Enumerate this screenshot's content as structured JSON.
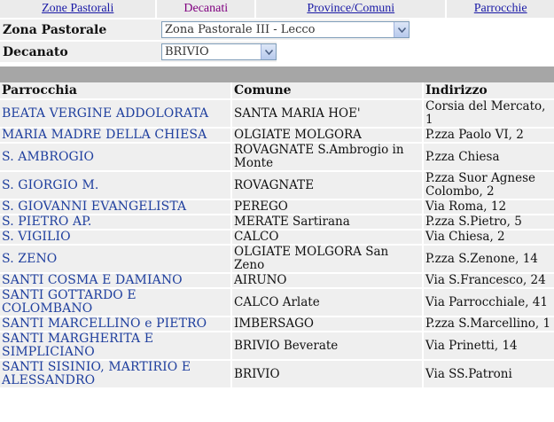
{
  "tabs": [
    {
      "label": "Zone Pastorali",
      "link": true
    },
    {
      "label": "Decanati",
      "link": false
    },
    {
      "label": "Province/Comuni",
      "link": true
    },
    {
      "label": "Parrocchie",
      "link": true
    }
  ],
  "filters": {
    "zona_label": "Zona Pastorale",
    "zona_value": "Zona Pastorale III - Lecco",
    "decanato_label": "Decanato",
    "decanato_value": "BRIVIO"
  },
  "table": {
    "headers": [
      "Parrocchia",
      "Comune",
      "Indirizzo"
    ],
    "rows": [
      {
        "parrocchia": "BEATA VERGINE ADDOLORATA",
        "comune": "SANTA MARIA HOE'",
        "indirizzo": "Corsia del Mercato, 1"
      },
      {
        "parrocchia": "MARIA MADRE DELLA CHIESA",
        "comune": "OLGIATE MOLGORA",
        "indirizzo": "P.zza Paolo VI, 2"
      },
      {
        "parrocchia": "S. AMBROGIO",
        "comune": "ROVAGNATE S.Ambrogio in Monte",
        "indirizzo": "P.zza Chiesa"
      },
      {
        "parrocchia": "S. GIORGIO M.",
        "comune": "ROVAGNATE",
        "indirizzo": "P.zza Suor Agnese Colombo, 2"
      },
      {
        "parrocchia": "S. GIOVANNI EVANGELISTA",
        "comune": "PEREGO",
        "indirizzo": "Via Roma, 12"
      },
      {
        "parrocchia": "S. PIETRO AP.",
        "comune": "MERATE Sartirana",
        "indirizzo": "P.zza S.Pietro, 5"
      },
      {
        "parrocchia": "S. VIGILIO",
        "comune": "CALCO",
        "indirizzo": "Via Chiesa, 2"
      },
      {
        "parrocchia": "S. ZENO",
        "comune": "OLGIATE MOLGORA San Zeno",
        "indirizzo": "P.zza S.Zenone, 14"
      },
      {
        "parrocchia": "SANTI COSMA E DAMIANO",
        "comune": "AIRUNO",
        "indirizzo": "Via S.Francesco, 24"
      },
      {
        "parrocchia": "SANTI GOTTARDO E COLOMBANO",
        "comune": "CALCO Arlate",
        "indirizzo": "Via Parrocchiale, 41"
      },
      {
        "parrocchia": "SANTI MARCELLINO e PIETRO",
        "comune": "IMBERSAGO",
        "indirizzo": "P.zza S.Marcellino, 1"
      },
      {
        "parrocchia": "SANTI MARGHERITA E SIMPLICIANO",
        "comune": "BRIVIO Beverate",
        "indirizzo": "Via Prinetti, 14"
      },
      {
        "parrocchia": "SANTI SISINIO, MARTIRIO E ALESSANDRO",
        "comune": "BRIVIO",
        "indirizzo": "Via SS.Patroni"
      }
    ]
  }
}
